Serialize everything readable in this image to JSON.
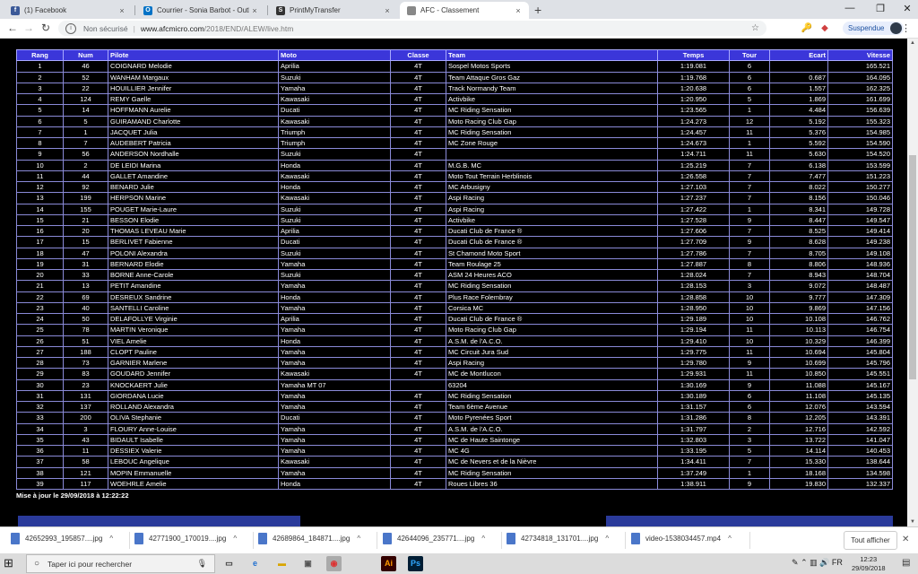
{
  "browser": {
    "tabs": [
      {
        "label": "(1) Facebook",
        "icon": "facebook-icon",
        "icon_color": "#3b5998",
        "icon_char": "f"
      },
      {
        "label": "Courrier - Sonia Barbot - Outlook",
        "icon": "outlook-icon",
        "icon_color": "#0072c6",
        "icon_char": "O"
      },
      {
        "label": "PrintMyTransfer",
        "icon": "printmytransfer-icon",
        "icon_color": "#333333",
        "icon_char": "S"
      },
      {
        "label": "AFC - Classement",
        "icon": "page-icon",
        "icon_color": "#888888",
        "icon_char": ""
      }
    ],
    "security_label": "Non sécurisé",
    "url_host": "www.afcmicro.com",
    "url_path": "/2018/END/ALEW/live.htm",
    "profile_label": "Suspendue"
  },
  "table": {
    "headers": {
      "rang": "Rang",
      "num": "Num",
      "pilote": "Pilote",
      "moto": "Moto",
      "classe": "Classe",
      "team": "Team",
      "temps": "Temps",
      "tour": "Tour",
      "ecart": "Ecart",
      "vitesse": "Vitesse"
    },
    "rows": [
      {
        "rang": "1",
        "num": "46",
        "pilote": "COIGNARD Melodie",
        "moto": "Aprilia",
        "classe": "4T",
        "team": "Sospel Motos Sports",
        "temps": "1:19.081",
        "tour": "6",
        "ecart": "",
        "vitesse": "165.521"
      },
      {
        "rang": "2",
        "num": "52",
        "pilote": "WANHAM Margaux",
        "moto": "Suzuki",
        "classe": "4T",
        "team": "Team Attaque Gros Gaz",
        "temps": "1:19.768",
        "tour": "6",
        "ecart": "0.687",
        "vitesse": "164.095"
      },
      {
        "rang": "3",
        "num": "22",
        "pilote": "HOUILLIER Jennifer",
        "moto": "Yamaha",
        "classe": "4T",
        "team": "Track Normandy Team",
        "temps": "1:20.638",
        "tour": "6",
        "ecart": "1.557",
        "vitesse": "162.325"
      },
      {
        "rang": "4",
        "num": "124",
        "pilote": "REMY Gaelle",
        "moto": "Kawasaki",
        "classe": "4T",
        "team": "Activbike",
        "temps": "1:20.950",
        "tour": "5",
        "ecart": "1.869",
        "vitesse": "161.699"
      },
      {
        "rang": "5",
        "num": "14",
        "pilote": "HOFFMANN Aurelie",
        "moto": "Ducati",
        "classe": "4T",
        "team": "MC Riding Sensation",
        "temps": "1:23.565",
        "tour": "1",
        "ecart": "4.484",
        "vitesse": "156.639"
      },
      {
        "rang": "6",
        "num": "5",
        "pilote": "GUIRAMAND Charlotte",
        "moto": "Kawasaki",
        "classe": "4T",
        "team": "Moto Racing Club Gap",
        "temps": "1:24.273",
        "tour": "12",
        "ecart": "5.192",
        "vitesse": "155.323"
      },
      {
        "rang": "7",
        "num": "1",
        "pilote": "JACQUET Julia",
        "moto": "Triumph",
        "classe": "4T",
        "team": "MC Riding Sensation",
        "temps": "1:24.457",
        "tour": "11",
        "ecart": "5.376",
        "vitesse": "154.985"
      },
      {
        "rang": "8",
        "num": "7",
        "pilote": "AUDEBERT Patricia",
        "moto": "Triumph",
        "classe": "4T",
        "team": "MC Zone Rouge",
        "temps": "1:24.673",
        "tour": "1",
        "ecart": "5.592",
        "vitesse": "154.590"
      },
      {
        "rang": "9",
        "num": "56",
        "pilote": "ANDERSON Nordhalle",
        "moto": "Suzuki",
        "classe": "4T",
        "team": "",
        "temps": "1:24.711",
        "tour": "11",
        "ecart": "5.630",
        "vitesse": "154.520"
      },
      {
        "rang": "10",
        "num": "2",
        "pilote": "DE LEIDI Marina",
        "moto": "Honda",
        "classe": "4T",
        "team": "M.G.B. MC",
        "temps": "1:25.219",
        "tour": "7",
        "ecart": "6.138",
        "vitesse": "153.599"
      },
      {
        "rang": "11",
        "num": "44",
        "pilote": "GALLET Amandine",
        "moto": "Kawasaki",
        "classe": "4T",
        "team": "Moto Tout Terrain Herblinois",
        "temps": "1:26.558",
        "tour": "7",
        "ecart": "7.477",
        "vitesse": "151.223"
      },
      {
        "rang": "12",
        "num": "92",
        "pilote": "BENARD Julie",
        "moto": "Honda",
        "classe": "4T",
        "team": "MC Arbusigny",
        "temps": "1:27.103",
        "tour": "7",
        "ecart": "8.022",
        "vitesse": "150.277"
      },
      {
        "rang": "13",
        "num": "199",
        "pilote": "HERPSON Marine",
        "moto": "Kawasaki",
        "classe": "4T",
        "team": "Aspi Racing",
        "temps": "1:27.237",
        "tour": "7",
        "ecart": "8.156",
        "vitesse": "150.046"
      },
      {
        "rang": "14",
        "num": "155",
        "pilote": "POUGET Marie-Laure",
        "moto": "Suzuki",
        "classe": "4T",
        "team": "Aspi Racing",
        "temps": "1:27.422",
        "tour": "1",
        "ecart": "8.341",
        "vitesse": "149.728"
      },
      {
        "rang": "15",
        "num": "21",
        "pilote": "BESSON Elodie",
        "moto": "Suzuki",
        "classe": "4T",
        "team": "Activbike",
        "temps": "1:27.528",
        "tour": "9",
        "ecart": "8.447",
        "vitesse": "149.547"
      },
      {
        "rang": "16",
        "num": "20",
        "pilote": "THOMAS LEVEAU Marie",
        "moto": "Aprilia",
        "classe": "4T",
        "team": "Ducati Club de France ®",
        "temps": "1:27.606",
        "tour": "7",
        "ecart": "8.525",
        "vitesse": "149.414"
      },
      {
        "rang": "17",
        "num": "15",
        "pilote": "BERLIVET Fabienne",
        "moto": "Ducati",
        "classe": "4T",
        "team": "Ducati Club de France ®",
        "temps": "1:27.709",
        "tour": "9",
        "ecart": "8.628",
        "vitesse": "149.238"
      },
      {
        "rang": "18",
        "num": "47",
        "pilote": "POLONI Alexandra",
        "moto": "Suzuki",
        "classe": "4T",
        "team": "St Chamond Moto Sport",
        "temps": "1:27.786",
        "tour": "7",
        "ecart": "8.705",
        "vitesse": "149.108"
      },
      {
        "rang": "19",
        "num": "31",
        "pilote": "BERNARD Elodie",
        "moto": "Yamaha",
        "classe": "4T",
        "team": "Team Roulage 25",
        "temps": "1:27.887",
        "tour": "8",
        "ecart": "8.806",
        "vitesse": "148.936"
      },
      {
        "rang": "20",
        "num": "33",
        "pilote": "BORNE Anne-Carole",
        "moto": "Suzuki",
        "classe": "4T",
        "team": "ASM 24 Heures ACO",
        "temps": "1:28.024",
        "tour": "7",
        "ecart": "8.943",
        "vitesse": "148.704"
      },
      {
        "rang": "21",
        "num": "13",
        "pilote": "PETIT Amandine",
        "moto": "Yamaha",
        "classe": "4T",
        "team": "MC Riding Sensation",
        "temps": "1:28.153",
        "tour": "3",
        "ecart": "9.072",
        "vitesse": "148.487"
      },
      {
        "rang": "22",
        "num": "69",
        "pilote": "DESREUX Sandrine",
        "moto": "Honda",
        "classe": "4T",
        "team": "Plus Race Folembray",
        "temps": "1:28.858",
        "tour": "10",
        "ecart": "9.777",
        "vitesse": "147.309"
      },
      {
        "rang": "23",
        "num": "40",
        "pilote": "SANTELLI Caroline",
        "moto": "Yamaha",
        "classe": "4T",
        "team": "Corsica MC",
        "temps": "1:28.950",
        "tour": "10",
        "ecart": "9.869",
        "vitesse": "147.156"
      },
      {
        "rang": "24",
        "num": "50",
        "pilote": "DELAFOLLYE Virginie",
        "moto": "Aprilia",
        "classe": "4T",
        "team": "Ducati Club de France ®",
        "temps": "1:29.189",
        "tour": "10",
        "ecart": "10.108",
        "vitesse": "146.762"
      },
      {
        "rang": "25",
        "num": "78",
        "pilote": "MARTIN Veronique",
        "moto": "Yamaha",
        "classe": "4T",
        "team": "Moto Racing Club Gap",
        "temps": "1:29.194",
        "tour": "11",
        "ecart": "10.113",
        "vitesse": "146.754"
      },
      {
        "rang": "26",
        "num": "51",
        "pilote": "VIEL Amelie",
        "moto": "Honda",
        "classe": "4T",
        "team": "A.S.M. de l'A.C.O.",
        "temps": "1:29.410",
        "tour": "10",
        "ecart": "10.329",
        "vitesse": "146.399"
      },
      {
        "rang": "27",
        "num": "188",
        "pilote": "CLOPT Pauline",
        "moto": "Yamaha",
        "classe": "4T",
        "team": "MC Circuit Jura Sud",
        "temps": "1:29.775",
        "tour": "11",
        "ecart": "10.694",
        "vitesse": "145.804"
      },
      {
        "rang": "28",
        "num": "73",
        "pilote": "GARNIER Marlene",
        "moto": "Yamaha",
        "classe": "4T",
        "team": "Aspi Racing",
        "temps": "1:29.780",
        "tour": "9",
        "ecart": "10.699",
        "vitesse": "145.796"
      },
      {
        "rang": "29",
        "num": "83",
        "pilote": "GOUDARD Jennifer",
        "moto": "Kawasaki",
        "classe": "4T",
        "team": "MC de Montlucon",
        "temps": "1:29.931",
        "tour": "11",
        "ecart": "10.850",
        "vitesse": "145.551"
      },
      {
        "rang": "30",
        "num": "23",
        "pilote": "KNOCKAERT Julie",
        "moto": "Yamaha MT 07",
        "classe": "",
        "team": "63204",
        "temps": "1:30.169",
        "tour": "9",
        "ecart": "11.088",
        "vitesse": "145.167"
      },
      {
        "rang": "31",
        "num": "131",
        "pilote": "GIORDANA Lucie",
        "moto": "Yamaha",
        "classe": "4T",
        "team": "MC Riding Sensation",
        "temps": "1:30.189",
        "tour": "6",
        "ecart": "11.108",
        "vitesse": "145.135"
      },
      {
        "rang": "32",
        "num": "137",
        "pilote": "ROLLAND Alexandra",
        "moto": "Yamaha",
        "classe": "4T",
        "team": "Team 6ème Avenue",
        "temps": "1:31.157",
        "tour": "6",
        "ecart": "12.076",
        "vitesse": "143.594"
      },
      {
        "rang": "33",
        "num": "200",
        "pilote": "OLIVA Stephanie",
        "moto": "Ducati",
        "classe": "4T",
        "team": "Moto Pyrenées Sport",
        "temps": "1:31.286",
        "tour": "8",
        "ecart": "12.205",
        "vitesse": "143.391"
      },
      {
        "rang": "34",
        "num": "3",
        "pilote": "FLOURY Anne-Louise",
        "moto": "Yamaha",
        "classe": "4T",
        "team": "A.S.M. de l'A.C.O.",
        "temps": "1:31.797",
        "tour": "2",
        "ecart": "12.716",
        "vitesse": "142.592"
      },
      {
        "rang": "35",
        "num": "43",
        "pilote": "BIDAULT Isabelle",
        "moto": "Yamaha",
        "classe": "4T",
        "team": "MC de Haute Saintonge",
        "temps": "1:32.803",
        "tour": "3",
        "ecart": "13.722",
        "vitesse": "141.047"
      },
      {
        "rang": "36",
        "num": "11",
        "pilote": "DESSIEX Valerie",
        "moto": "Yamaha",
        "classe": "4T",
        "team": "MC 4G",
        "temps": "1:33.195",
        "tour": "5",
        "ecart": "14.114",
        "vitesse": "140.453"
      },
      {
        "rang": "37",
        "num": "58",
        "pilote": "LEBOUC Angelique",
        "moto": "Kawasaki",
        "classe": "4T",
        "team": "MC de Nevers et de la Nièvre",
        "temps": "1:34.411",
        "tour": "7",
        "ecart": "15.330",
        "vitesse": "138.644"
      },
      {
        "rang": "38",
        "num": "121",
        "pilote": "MOPIN Emmanuelle",
        "moto": "Yamaha",
        "classe": "4T",
        "team": "MC Riding Sensation",
        "temps": "1:37.249",
        "tour": "1",
        "ecart": "18.168",
        "vitesse": "134.598"
      },
      {
        "rang": "39",
        "num": "117",
        "pilote": "WOEHRLE Amelie",
        "moto": "Honda",
        "classe": "4T",
        "team": "Roues Libres 36",
        "temps": "1:38.911",
        "tour": "9",
        "ecart": "19.830",
        "vitesse": "132.337"
      }
    ]
  },
  "update_text": "Mise à jour le 29/09/2018 à 12:22:22",
  "downloads": {
    "items": [
      "42652993_195857....jpg",
      "42771900_170019....jpg",
      "42689864_184871....jpg",
      "42644096_235771....jpg",
      "42734818_131701....jpg",
      "video-1538034457.mp4"
    ],
    "show_all_label": "Tout afficher"
  },
  "taskbar": {
    "search_placeholder": "Taper ici pour rechercher",
    "time": "12:23",
    "date": "29/09/2018",
    "tray_lang": "FR"
  }
}
